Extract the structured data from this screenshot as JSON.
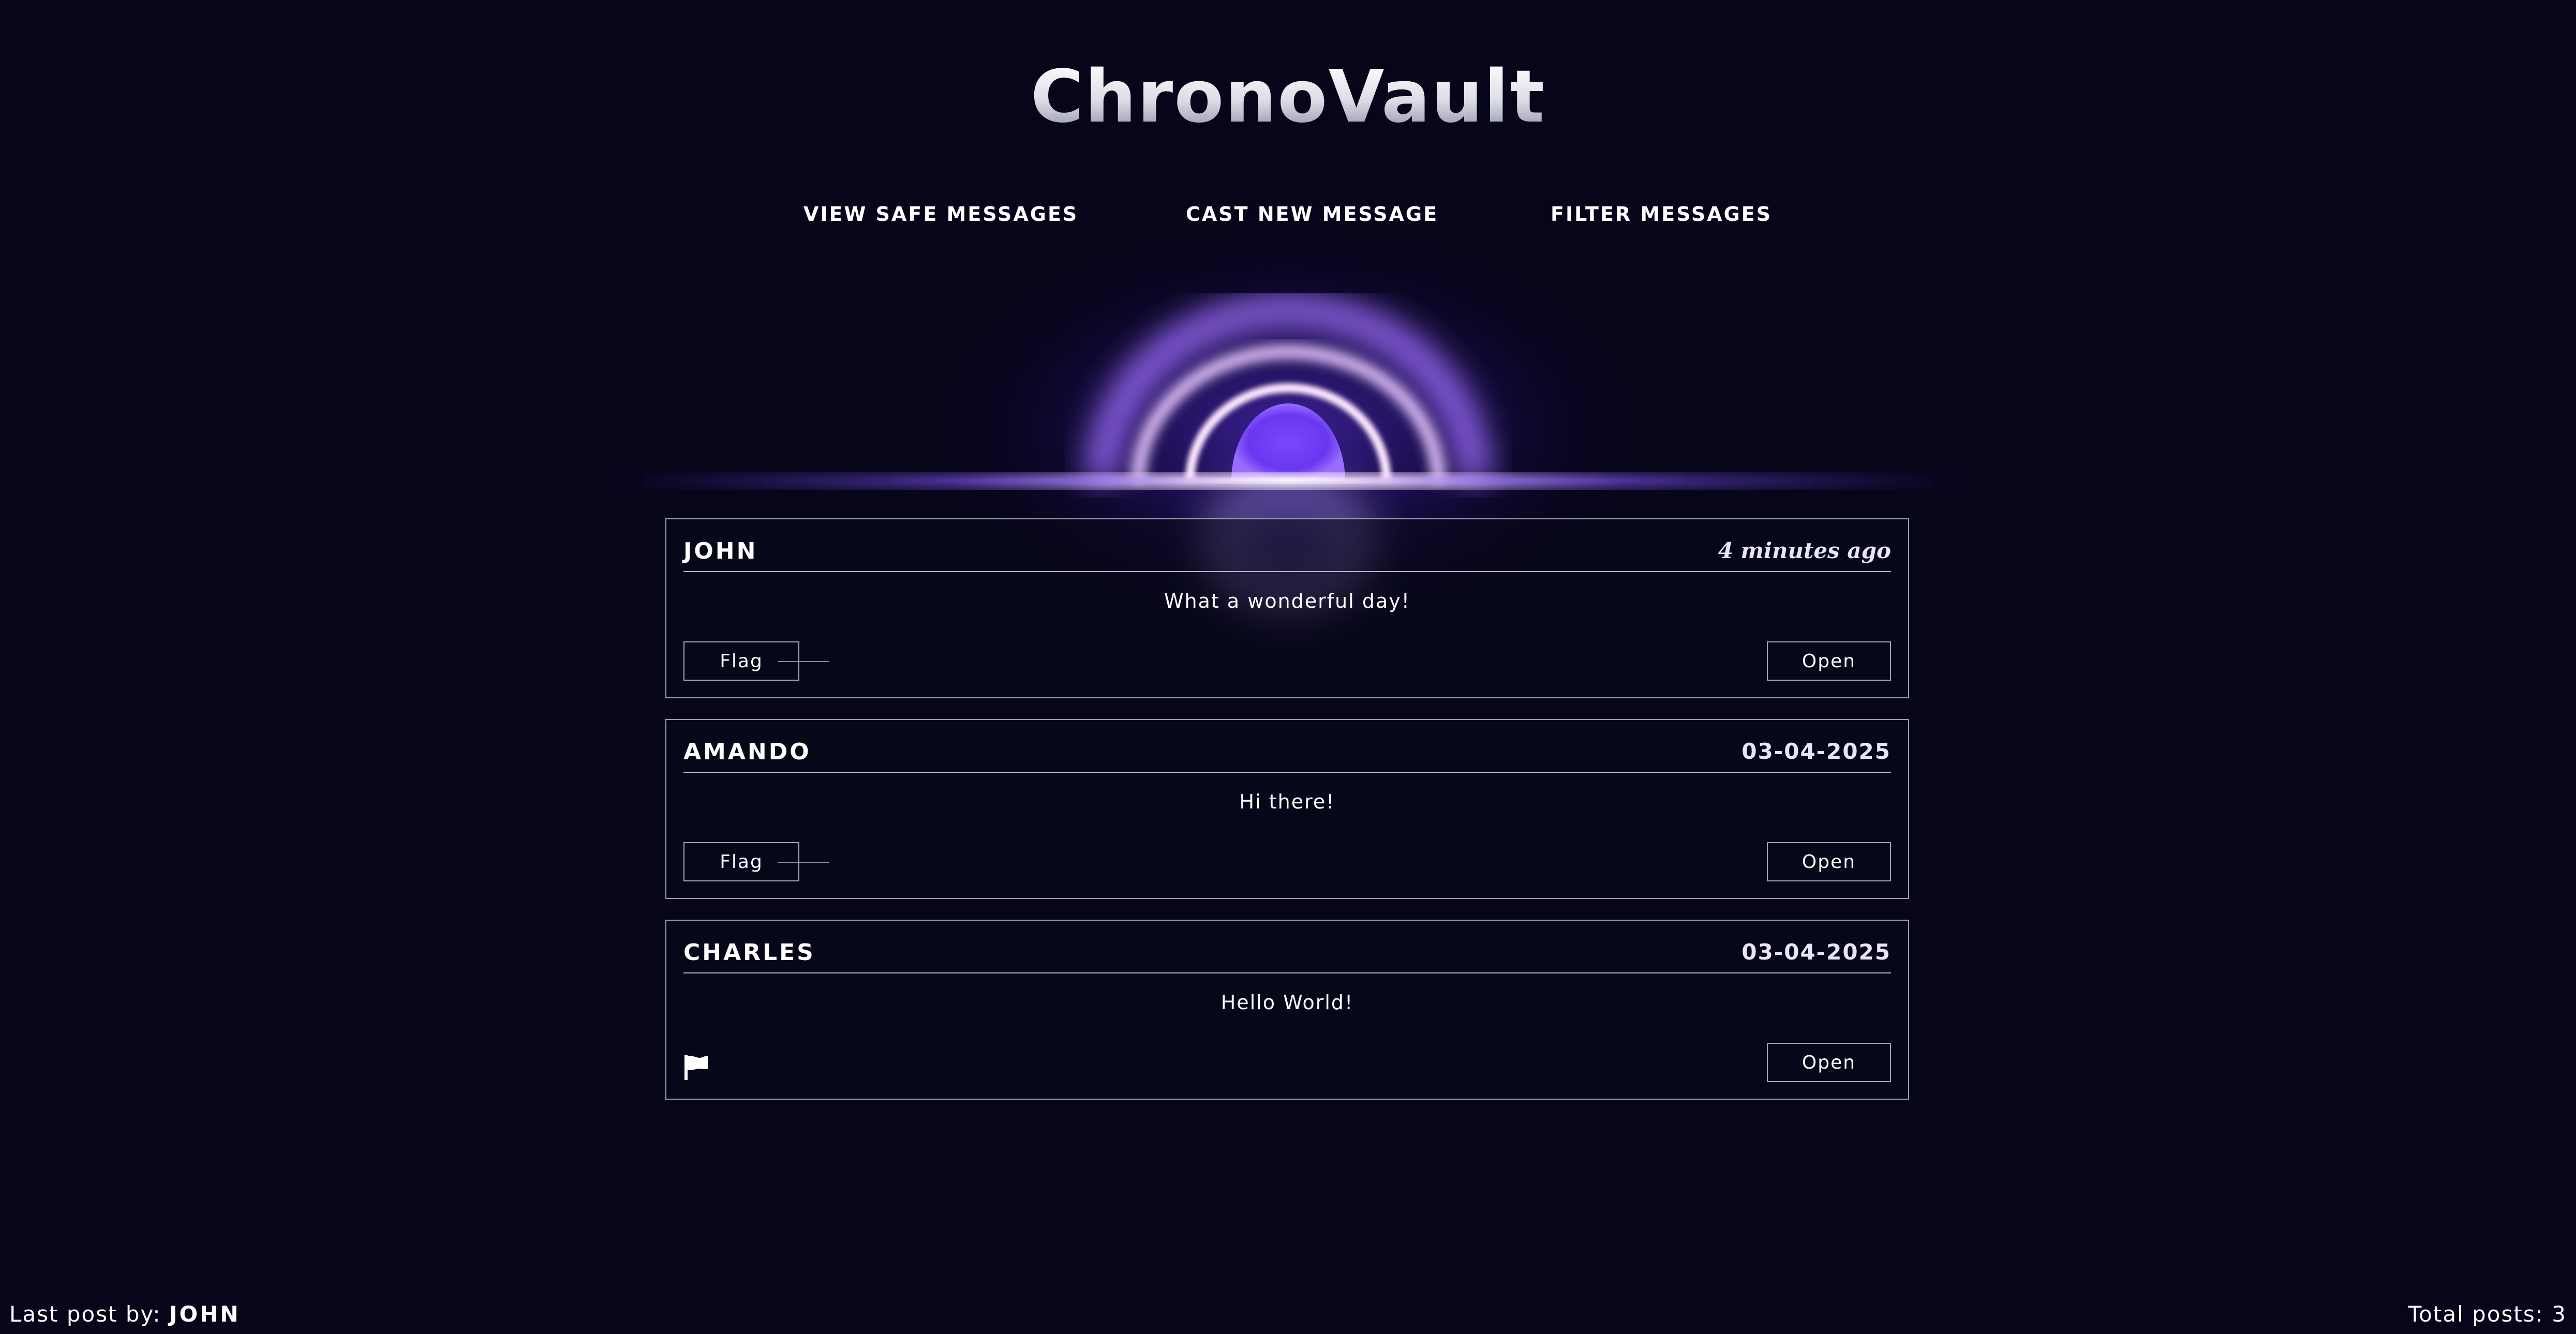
{
  "app": {
    "title": "ChronoVault"
  },
  "nav": {
    "items": [
      {
        "label": "View Safe Messages"
      },
      {
        "label": "Cast New Message"
      },
      {
        "label": "Filter Messages"
      }
    ]
  },
  "posts": [
    {
      "author": "JOHN",
      "time": "4 minutes ago",
      "message": "What a wonderful day!",
      "flag_label": "Flag",
      "open_label": "Open",
      "flagged": false
    },
    {
      "author": "AMANDO",
      "time": "03-04-2025",
      "message": "Hi there!",
      "flag_label": "Flag",
      "open_label": "Open",
      "flagged": false
    },
    {
      "author": "CHARLES",
      "time": "03-04-2025",
      "message": "Hello World!",
      "open_label": "Open",
      "flagged": true,
      "flag_icon": "flag-icon"
    }
  ],
  "footer": {
    "last_post_label": "Last post by:",
    "last_post_user": "JOHN",
    "total_posts_label": "Total posts:",
    "total_posts_count": "3"
  },
  "colors": {
    "background": "#06051a",
    "accent": "#7b4dff",
    "border": "#9e9cb4"
  }
}
